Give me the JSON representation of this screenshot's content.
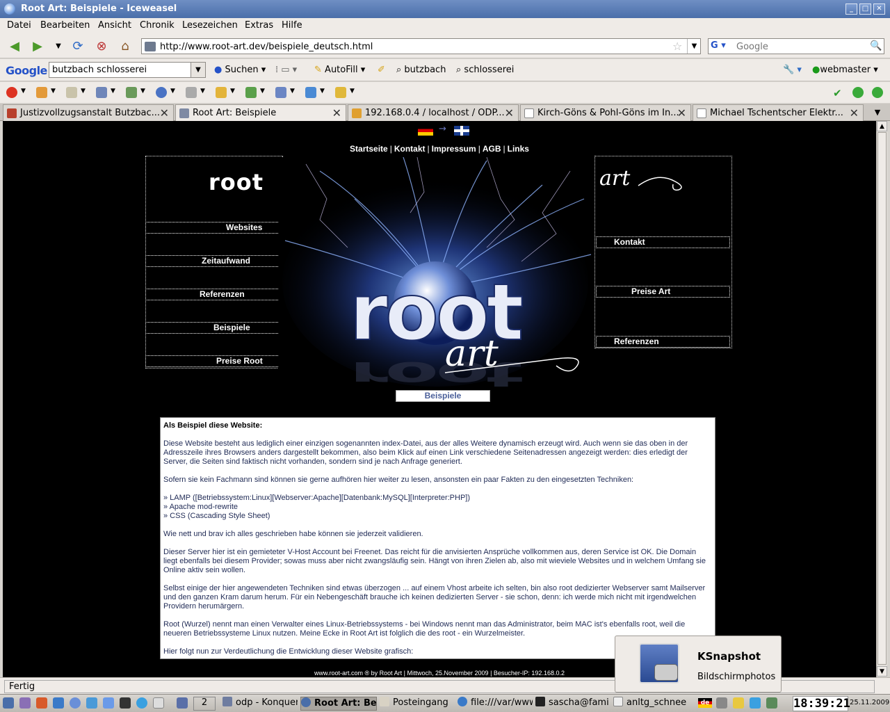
{
  "window": {
    "title": "Root Art: Beispiele - Iceweasel"
  },
  "menu": [
    "Datei",
    "Bearbeiten",
    "Ansicht",
    "Chronik",
    "Lesezeichen",
    "Extras",
    "Hilfe"
  ],
  "url": "http://www.root-art.dev/beispiele_deutsch.html",
  "search": {
    "engine": "G",
    "placeholder": "Google"
  },
  "googlebar": {
    "logo": "Google",
    "query": "butzbach schlosserei",
    "suchen": "Suchen",
    "autofill": "AutoFill",
    "term1": "butzbach",
    "term2": "schlosserei",
    "user": "webmaster"
  },
  "tabs": [
    {
      "label": "Justizvollzugsanstalt Butzbac...",
      "active": false
    },
    {
      "label": "Root Art: Beispiele",
      "active": true
    },
    {
      "label": "192.168.0.4 / localhost / ODP...",
      "active": false
    },
    {
      "label": "Kirch-Göns & Pohl-Göns im In...",
      "active": false
    },
    {
      "label": "Michael Tschentscher Elektr...",
      "active": false
    }
  ],
  "page": {
    "topnav": [
      "Startseite",
      "Kontakt",
      "Impressum",
      "AGB",
      "Links"
    ],
    "left_title": "root",
    "left_nav": [
      "Websites",
      "Zeitaufwand",
      "Referenzen",
      "Beispiele",
      "Preise Root"
    ],
    "right_title": "art",
    "right_nav": [
      "Kontakt",
      "Preise Art",
      "Referenzen"
    ],
    "hero_logo": "root",
    "hero_art": "art",
    "section_label": "Beispiele",
    "article": {
      "heading": "Als Beispiel diese Website:",
      "p1": "Diese Website besteht aus lediglich einer einzigen sogenannten index-Datei, aus der alles Weitere dynamisch erzeugt wird. Auch wenn sie das oben in der Adresszeile ihres Browsers anders dargestellt bekommen, also beim Klick auf einen Link verschiedene Seitenadressen angezeigt werden: dies erledigt der Server, die Seiten sind faktisch nicht vorhanden, sondern sind je nach Anfrage generiert.",
      "p2": "Sofern sie kein Fachmann sind können sie gerne aufhören hier weiter zu lesen, ansonsten ein paar Fakten zu den eingesetzten Techniken:",
      "list": [
        "» LAMP ([Betriebssystem:Linux][Webserver:Apache][Datenbank:MySQL][Interpreter:PHP])",
        "» Apache mod-rewrite",
        "» CSS (Cascading Style Sheet)"
      ],
      "p3": "Wie nett und brav ich alles geschrieben habe können sie jederzeit validieren.",
      "p4": "Dieser Server hier ist ein gemieteter V-Host Account bei Freenet. Das reicht für die anvisierten Ansprüche vollkommen aus, deren Service ist OK. Die Domain liegt ebenfalls bei diesem Provider; sowas muss aber nicht zwangsläufig sein. Hängt von ihren Zielen ab, also mit wieviele Websites und in welchem Umfang sie Online aktiv sein wollen.",
      "p5": "Selbst einige der hier angewendeten Techniken sind etwas überzogen ... auf einem Vhost arbeite ich selten, bin also root dedizierter Webserver samt Mailserver und den ganzen Kram darum herum. Für ein Nebengeschäft brauche ich keinen dedizierten Server - sie schon, denn: ich werde mich nicht mit irgendwelchen Providern herumärgern.",
      "p6": "Root (Wurzel) nennt man einen Verwalter eines Linux-Betriebssystems - bei Windows nennt man das Administrator, beim MAC ist's ebenfalls root, weil die neueren Betriebssysteme Linux nutzen. Meine Ecke in Root Art ist folglich die des root - ein Wurzelmeister.",
      "p7": "Hier folgt nun zur Verdeutlichung die Entwicklung dieser Website grafisch:"
    },
    "footer": "www.root-art.com ® by  Root Art | Mittwoch, 25.November 2009 | Besucher-IP: 192.168.0.2"
  },
  "status": "Fertig",
  "notification": {
    "title": "KSnapshot",
    "subtitle": "Bildschirmphotos"
  },
  "taskbar": {
    "desk": "2",
    "tasks": [
      {
        "label": "odp - Konquer",
        "active": false
      },
      {
        "label": "Root Art: Be",
        "active": true
      },
      {
        "label": "Posteingang",
        "active": false
      },
      {
        "label": "file:///var/www",
        "active": false
      },
      {
        "label": "sascha@fami",
        "active": false
      },
      {
        "label": "anltg_schnee",
        "active": false
      }
    ],
    "lang": "de",
    "clock": "18:39:21",
    "date": "25.11.2009"
  },
  "colors": {
    "page_bg": "#000000",
    "link_text": "#1f2a55",
    "section_label": "#4a5f99"
  }
}
